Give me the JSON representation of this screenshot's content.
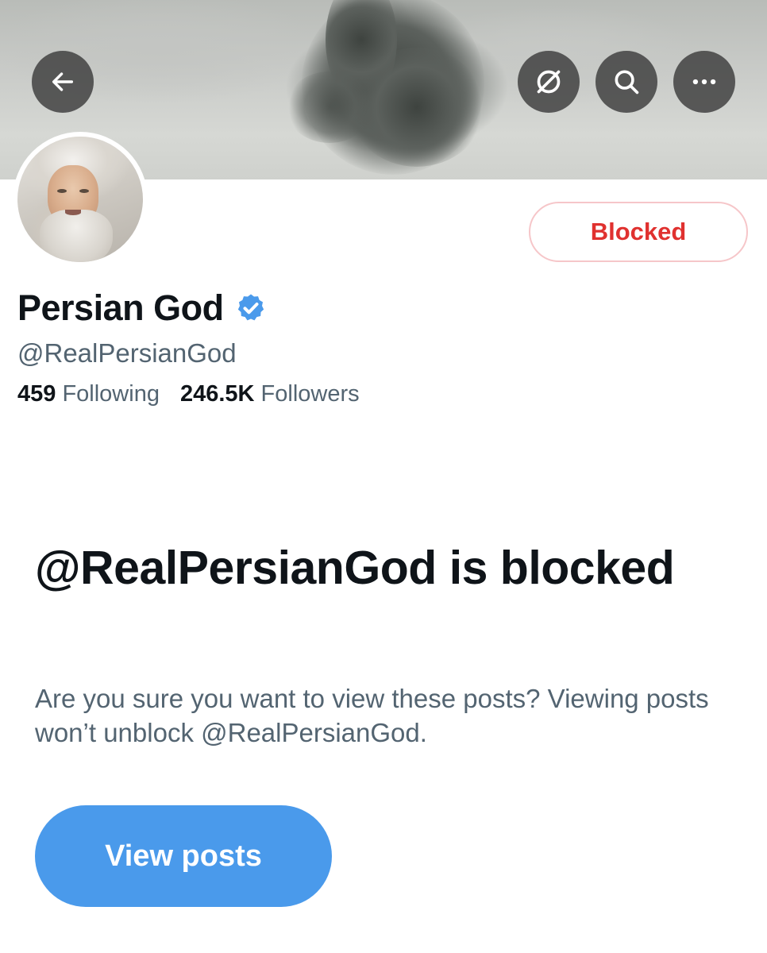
{
  "header": {
    "back_icon": "arrow-left-icon",
    "grok_icon": "slashed-circle-icon",
    "search_icon": "search-icon",
    "more_icon": "more-horizontal-icon"
  },
  "profile": {
    "display_name": "Persian God",
    "verified_icon": "verified-badge-icon",
    "verified_color": "#4a9aeb",
    "handle": "@RealPersianGod",
    "following_count": "459",
    "following_label": "Following",
    "followers_count": "246.5K",
    "followers_label": "Followers",
    "blocked_button_label": "Blocked",
    "blocked_color": "#e0312f"
  },
  "blocked_notice": {
    "title": "@RealPersianGod is blocked",
    "description": "Are you sure you want to view these posts? Viewing posts won’t unblock @RealPersianGod.",
    "view_button_label": "View posts",
    "accent_color": "#4a9aeb"
  }
}
